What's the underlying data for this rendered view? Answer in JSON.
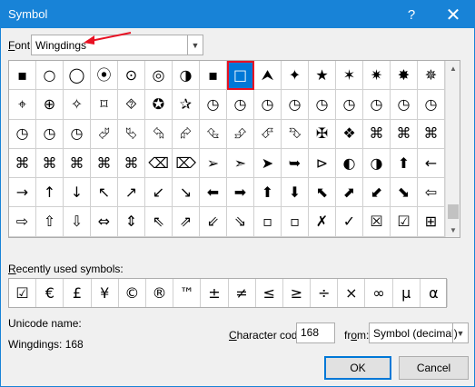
{
  "window": {
    "title": "Symbol",
    "help": "?",
    "close": "✕"
  },
  "font": {
    "label_accel": "F",
    "label_rest": "ont:",
    "value": "Wingdings"
  },
  "grid": {
    "rows": [
      [
        "▪",
        "○",
        "◯",
        "⦿",
        "⊙",
        "◎",
        "◑",
        "▪",
        "□",
        "⮝",
        "✦",
        "★",
        "✶",
        "✷",
        "✸",
        "✵"
      ],
      [
        "⌖",
        "⊕",
        "✧",
        "⌑",
        "⯑",
        "✪",
        "✰",
        "◷",
        "◷",
        "◷",
        "◷",
        "◷",
        "◷",
        "◷",
        "◷",
        "◷"
      ],
      [
        "◷",
        "◷",
        "◷",
        "⮰",
        "⮱",
        "⮲",
        "⮳",
        "⮴",
        "⮵",
        "⮶",
        "⮷",
        "✠",
        "❖",
        "⌘",
        "⌘",
        "⌘"
      ],
      [
        "⌘",
        "⌘",
        "⌘",
        "⌘",
        "⌘",
        "⌫",
        "⌦",
        "➢",
        "➣",
        "➤",
        "➥",
        "⊳",
        "◐",
        "◑",
        "⬆",
        "←"
      ],
      [
        "→",
        "↑",
        "↓",
        "↖",
        "↗",
        "↙",
        "↘",
        "⬅",
        "➡",
        "⬆",
        "⬇",
        "⬉",
        "⬈",
        "⬋",
        "⬊",
        "⇦"
      ],
      [
        "⇨",
        "⇧",
        "⇩",
        "⇔",
        "⇕",
        "⇖",
        "⇗",
        "⇙",
        "⇘",
        "▫",
        "▫",
        "✗",
        "✓",
        "☒",
        "☑",
        "⊞"
      ]
    ],
    "selected_row": 0,
    "selected_col": 8
  },
  "recent": {
    "label_accel": "R",
    "label_rest": "ecently used symbols:",
    "symbols": [
      "☑",
      "€",
      "£",
      "¥",
      "©",
      "®",
      "™",
      "±",
      "≠",
      "≤",
      "≥",
      "÷",
      "×",
      "∞",
      "μ",
      "α"
    ]
  },
  "unicode_name": {
    "label": "Unicode name:",
    "value": "Wingdings: 168"
  },
  "char_code": {
    "label_accel": "C",
    "label_rest": "haracter code:",
    "value": "168"
  },
  "from": {
    "label_pre": "fr",
    "label_accel": "o",
    "label_post": "m:",
    "value": "Symbol (decimal)"
  },
  "buttons": {
    "ok": "OK",
    "cancel": "Cancel"
  },
  "colors": {
    "title_bar": "#1883d7",
    "selection": "#0078d7",
    "highlight": "#e81123"
  }
}
